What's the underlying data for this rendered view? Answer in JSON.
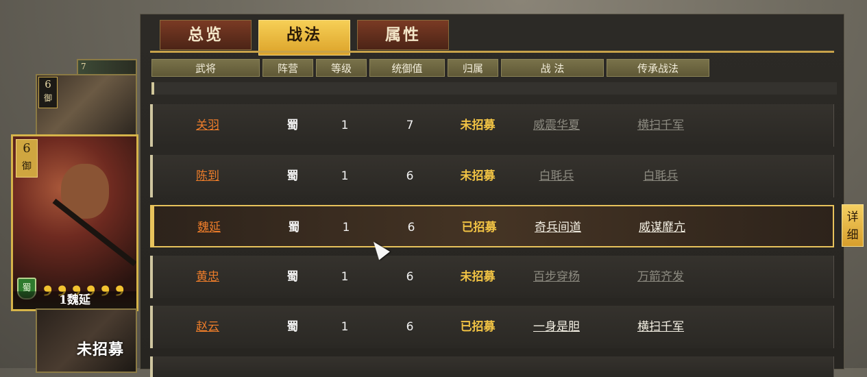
{
  "tabs": [
    {
      "label": "总览",
      "active": false
    },
    {
      "label": "战法",
      "active": true
    },
    {
      "label": "属性",
      "active": false
    }
  ],
  "headers": [
    "武将",
    "阵营",
    "等级",
    "统御值",
    "归属",
    "战 法",
    "传承战法"
  ],
  "rows": [
    {
      "name": "关羽",
      "camp": "蜀",
      "level": "1",
      "command": "7",
      "owner": "未招募",
      "skill": "威震华夏",
      "skill_active": false,
      "inherit": "横扫千军",
      "inherit_active": false
    },
    {
      "name": "陈到",
      "camp": "蜀",
      "level": "1",
      "command": "6",
      "owner": "未招募",
      "skill": "白毦兵",
      "skill_active": false,
      "inherit": "白毦兵",
      "inherit_active": false
    },
    {
      "name": "魏延",
      "camp": "蜀",
      "level": "1",
      "command": "6",
      "owner": "已招募",
      "skill": "奇兵间道",
      "skill_active": true,
      "inherit": "威谋靡亢",
      "inherit_active": true,
      "selected": true
    },
    {
      "name": "黄忠",
      "camp": "蜀",
      "level": "1",
      "command": "6",
      "owner": "未招募",
      "skill": "百步穿杨",
      "skill_active": false,
      "inherit": "万箭齐发",
      "inherit_active": false
    },
    {
      "name": "赵云",
      "camp": "蜀",
      "level": "1",
      "command": "6",
      "owner": "已招募",
      "skill": "一身是胆",
      "skill_active": true,
      "inherit": "横扫千军",
      "inherit_active": true
    }
  ],
  "detail_button": "详细",
  "cards": {
    "tiny_level": "7",
    "small_level": "6",
    "small_type": "御",
    "main_level": "6",
    "main_type": "御",
    "main_faction": "蜀",
    "main_stars": 6,
    "main_name": "1魏延",
    "bottom_status": "未招募"
  },
  "colors": {
    "accent_gold": "#e8c35c",
    "name_orange": "#ee7d2a",
    "owner_gold": "#f0c244",
    "tab_red": "#7a3a24"
  }
}
